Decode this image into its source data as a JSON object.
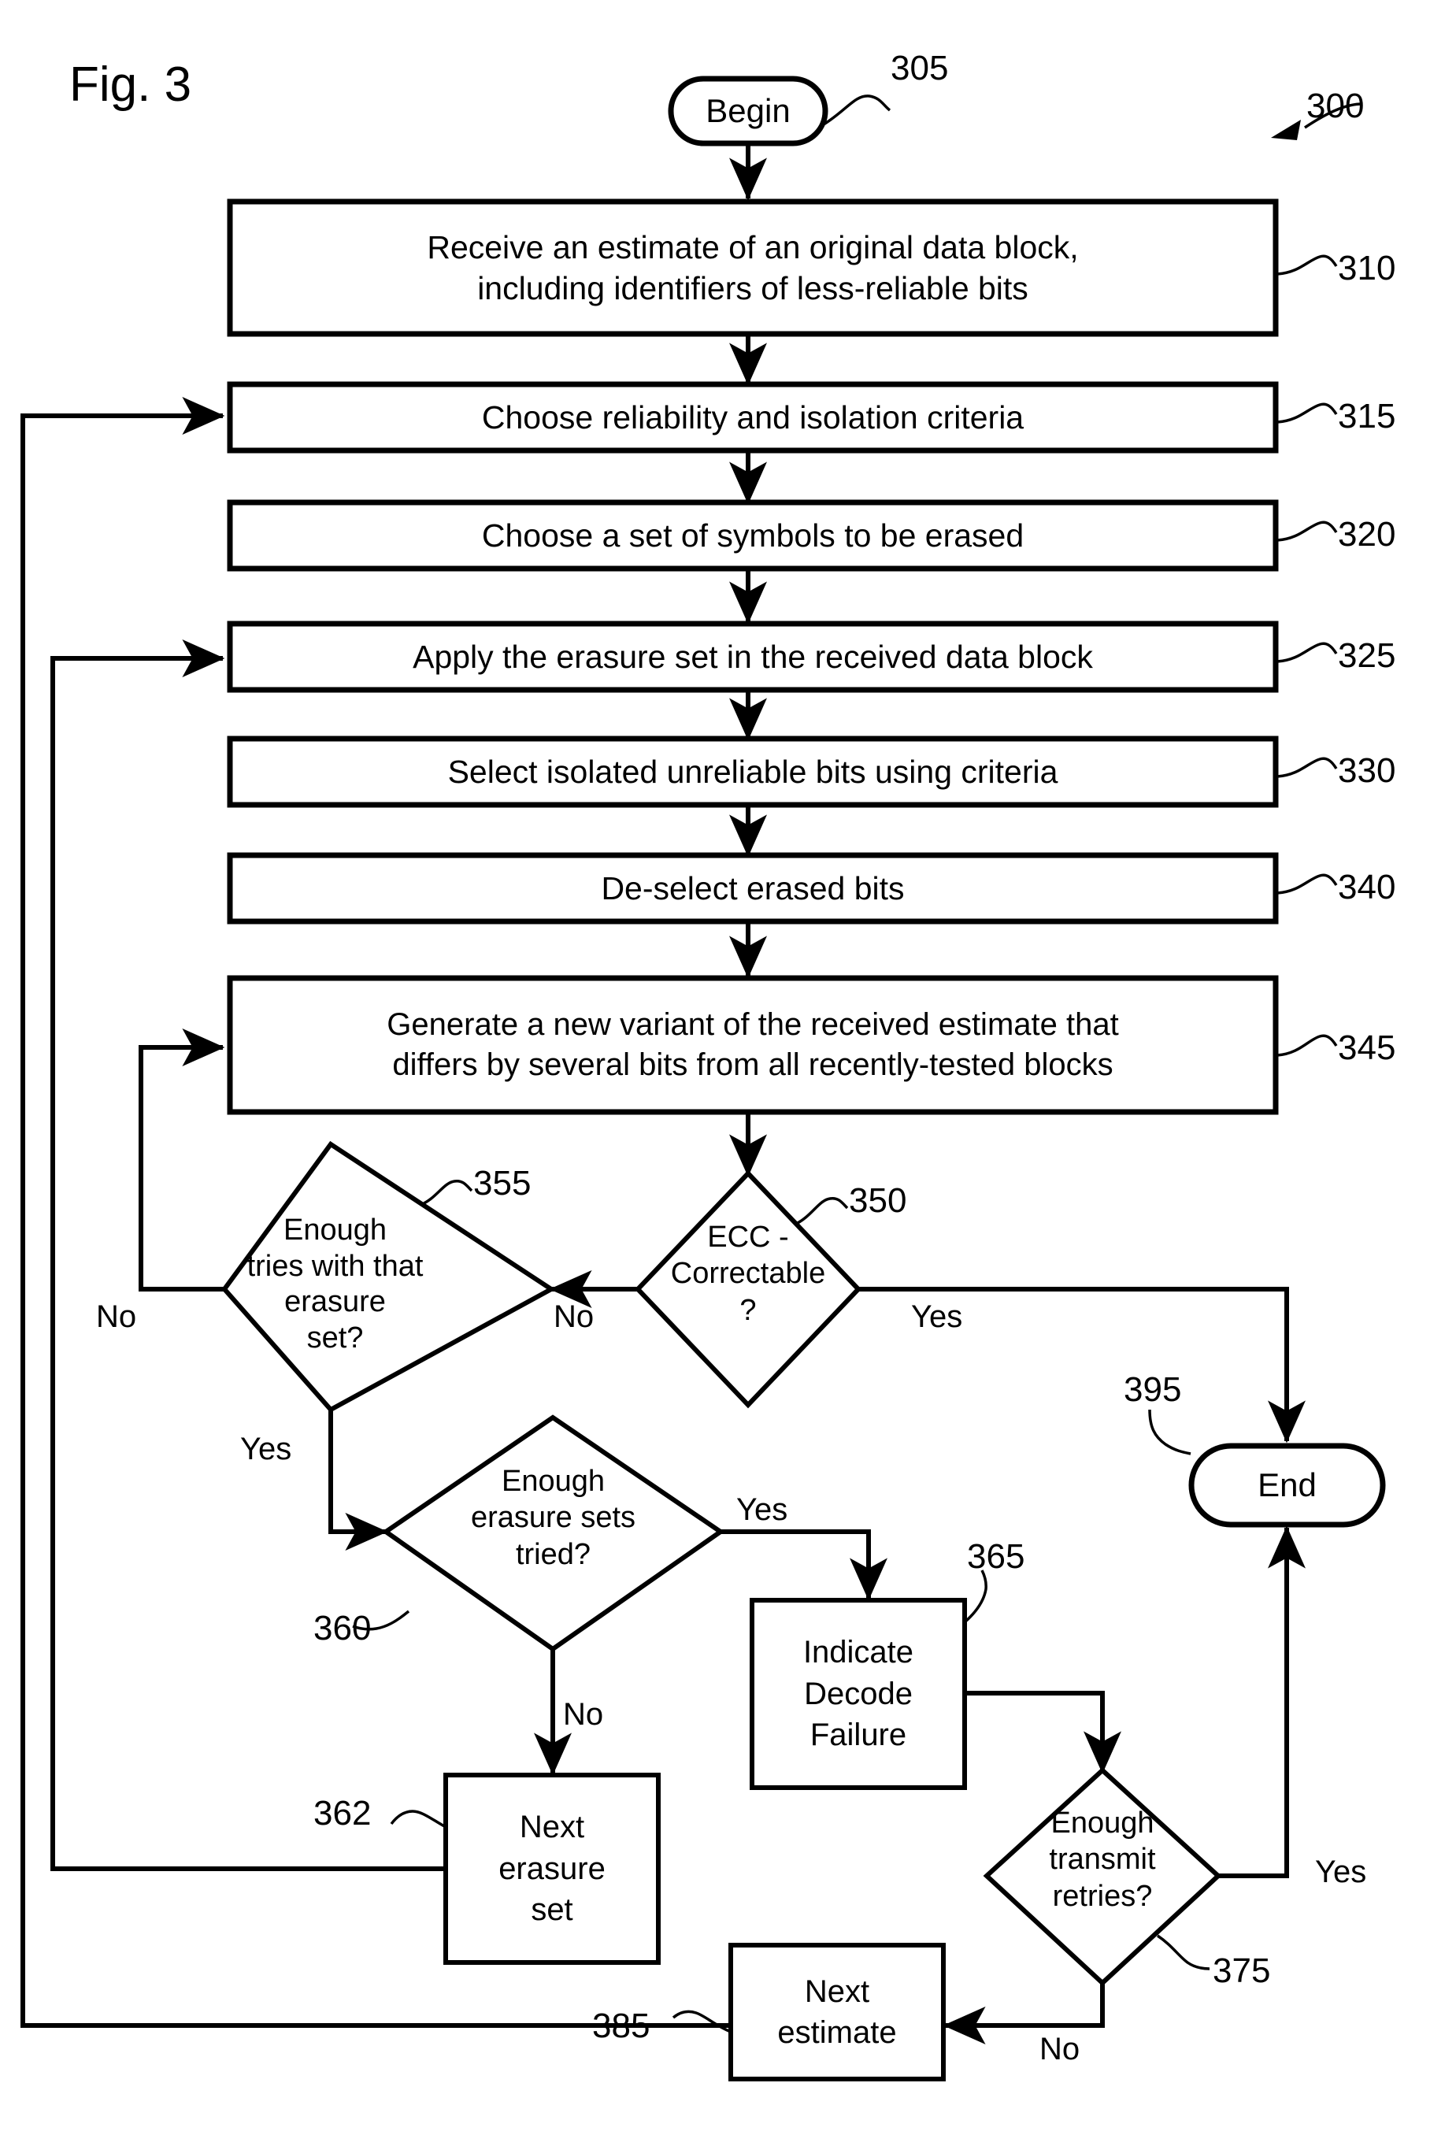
{
  "figure": {
    "label": "Fig. 3",
    "ref": "300"
  },
  "nodes": {
    "begin": {
      "label": "Begin",
      "ref": "305"
    },
    "s310": {
      "line1": "Receive an estimate of an original data block,",
      "line2": "including identifiers of less-reliable bits",
      "ref": "310"
    },
    "s315": {
      "line1": "Choose reliability and isolation criteria",
      "ref": "315"
    },
    "s320": {
      "line1": "Choose a set of symbols to be erased",
      "ref": "320"
    },
    "s325": {
      "line1": "Apply the erasure set in the received data block",
      "ref": "325"
    },
    "s330": {
      "line1": "Select isolated unreliable bits using criteria",
      "ref": "330"
    },
    "s340": {
      "line1": "De-select erased bits",
      "ref": "340"
    },
    "s345": {
      "line1": "Generate a new variant of the received estimate that",
      "line2": "differs by several bits from all recently-tested blocks",
      "ref": "345"
    },
    "d350": {
      "line1": "ECC -",
      "line2": "Correctable",
      "line3": "?",
      "ref": "350"
    },
    "d355": {
      "line1": "Enough",
      "line2": "tries with that",
      "line3": "erasure",
      "line4": "set?",
      "ref": "355"
    },
    "d360": {
      "line1": "Enough",
      "line2": "erasure sets",
      "line3": "tried?",
      "ref": "360"
    },
    "s362": {
      "line1": "Next",
      "line2": "erasure",
      "line3": "set",
      "ref": "362"
    },
    "s365": {
      "line1": "Indicate",
      "line2": "Decode",
      "line3": "Failure",
      "ref": "365"
    },
    "d375": {
      "line1": "Enough",
      "line2": "transmit",
      "line3": "retries?",
      "ref": "375"
    },
    "s385": {
      "line1": "Next",
      "line2": "estimate",
      "ref": "385"
    },
    "end": {
      "label": "End",
      "ref": "395"
    }
  },
  "edge_labels": {
    "d350_no": "No",
    "d350_yes": "Yes",
    "d355_no": "No",
    "d355_yes": "Yes",
    "d360_yes": "Yes",
    "d360_no": "No",
    "d375_yes": "Yes",
    "d375_no": "No"
  },
  "colors": {
    "stroke": "#000000",
    "fill": "#ffffff"
  }
}
